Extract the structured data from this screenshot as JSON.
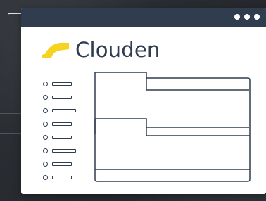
{
  "app": {
    "name": "Clouden"
  },
  "colors": {
    "titlebar": "#2f3d4f",
    "logo": "#f6d320",
    "text": "#2f3d4f",
    "window": "#ffffff"
  },
  "titlebar": {
    "controls": [
      "dot",
      "dot",
      "dot"
    ]
  },
  "icons": {
    "logo": "cloud-logo-icon",
    "bullet": "circle-bullet-icon"
  },
  "nav_items": [
    {
      "bar_width": 28
    },
    {
      "bar_width": 28
    },
    {
      "bar_width": 34
    },
    {
      "bar_width": 28
    },
    {
      "bar_width": 28
    },
    {
      "bar_width": 34
    },
    {
      "bar_width": 28
    },
    {
      "bar_width": 28
    }
  ]
}
